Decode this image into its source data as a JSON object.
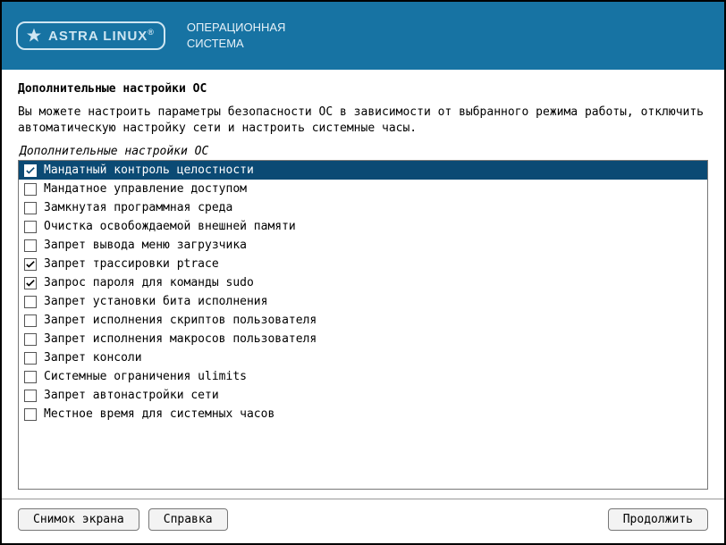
{
  "header": {
    "logo_text": "ASTRA LINUX",
    "logo_reg": "®",
    "subtitle_line1": "ОПЕРАЦИОННАЯ",
    "subtitle_line2": "СИСТЕМА"
  },
  "page": {
    "title": "Дополнительные настройки ОС",
    "description": "Вы можете настроить параметры безопасности ОС в зависимости от выбранного режима работы, отключить автоматическую настройку сети и настроить системные часы.",
    "section_label": "Дополнительные настройки ОС"
  },
  "options": [
    {
      "label": "Мандатный контроль целостности",
      "checked": true,
      "selected": true
    },
    {
      "label": "Мандатное управление доступом",
      "checked": false,
      "selected": false
    },
    {
      "label": "Замкнутая программная среда",
      "checked": false,
      "selected": false
    },
    {
      "label": "Очистка освобождаемой внешней памяти",
      "checked": false,
      "selected": false
    },
    {
      "label": "Запрет вывода меню загрузчика",
      "checked": false,
      "selected": false
    },
    {
      "label": "Запрет трассировки ptrace",
      "checked": true,
      "selected": false
    },
    {
      "label": "Запрос пароля для команды sudo",
      "checked": true,
      "selected": false
    },
    {
      "label": "Запрет установки бита исполнения",
      "checked": false,
      "selected": false
    },
    {
      "label": "Запрет исполнения скриптов пользователя",
      "checked": false,
      "selected": false
    },
    {
      "label": "Запрет исполнения макросов пользователя",
      "checked": false,
      "selected": false
    },
    {
      "label": "Запрет консоли",
      "checked": false,
      "selected": false
    },
    {
      "label": "Системные ограничения ulimits",
      "checked": false,
      "selected": false
    },
    {
      "label": "Запрет автонастройки сети",
      "checked": false,
      "selected": false
    },
    {
      "label": "Местное время для системных часов",
      "checked": false,
      "selected": false
    }
  ],
  "footer": {
    "screenshot": "Снимок экрана",
    "help": "Справка",
    "continue": "Продолжить"
  }
}
